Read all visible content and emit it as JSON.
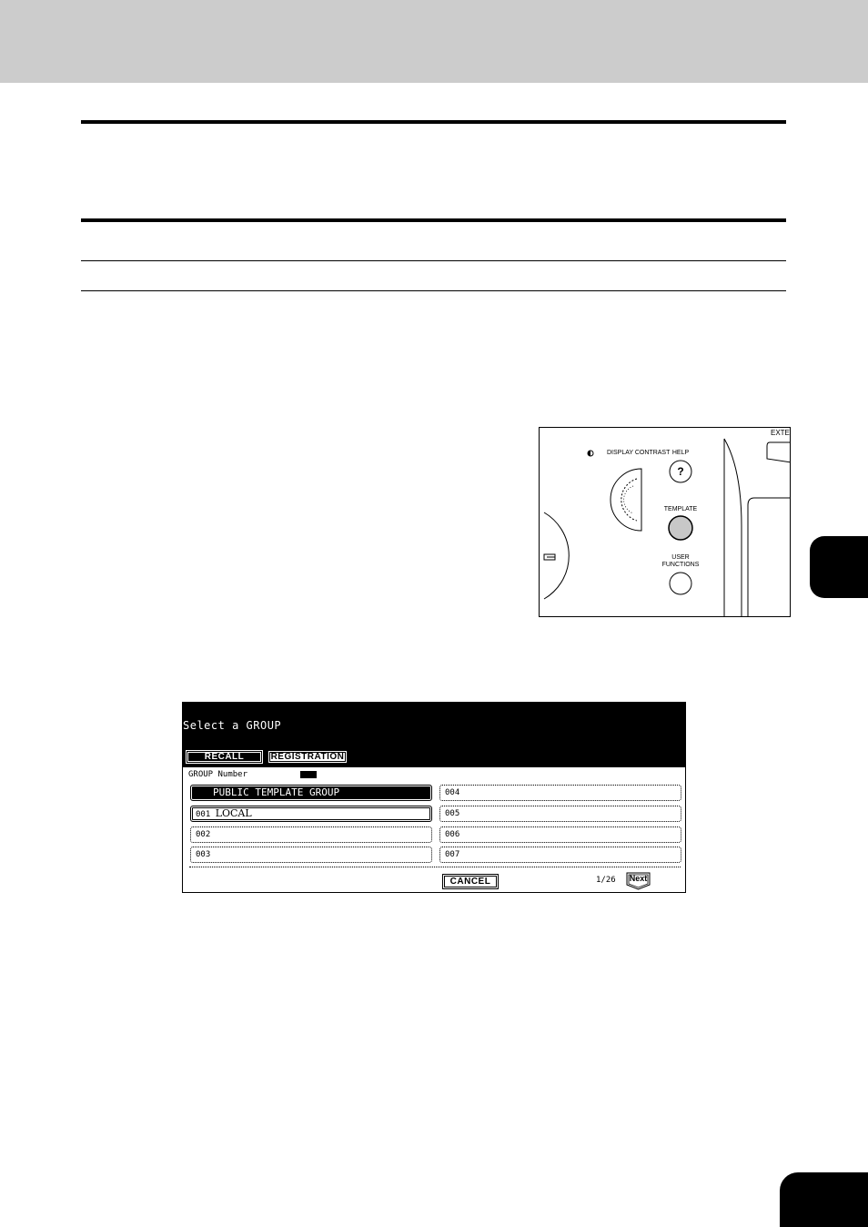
{
  "control_panel": {
    "display_contrast_label": "DISPLAY CONTRAST",
    "help_label": "HELP",
    "help_symbol": "?",
    "template_label": "TEMPLATE",
    "user_functions_label": "USER\nFUNCTIONS",
    "corner_label": "EXTE"
  },
  "screen": {
    "title": "Select a GROUP",
    "tabs": {
      "recall": "RECALL",
      "registration": "REGISTRATION"
    },
    "group_number_label": "GROUP Number",
    "groups_left": [
      {
        "label": "PUBLIC TEMPLATE GROUP"
      },
      {
        "num": "001",
        "label": "LOCAL"
      },
      {
        "label": "002"
      },
      {
        "label": "003"
      }
    ],
    "groups_right": [
      {
        "label": "004"
      },
      {
        "label": "005"
      },
      {
        "label": "006"
      },
      {
        "label": "007"
      }
    ],
    "cancel_label": "CANCEL",
    "page_indicator": "1/26",
    "next_label": "Next"
  },
  "colors": {
    "band": "#cccccc",
    "ink": "#000000"
  }
}
